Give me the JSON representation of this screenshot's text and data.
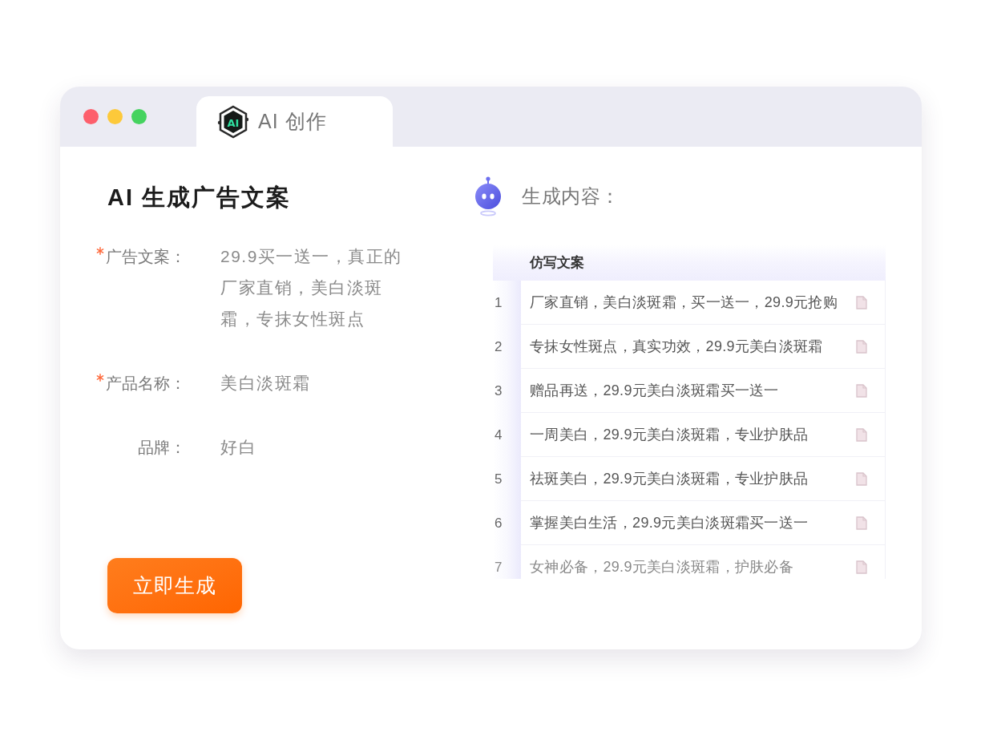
{
  "window": {
    "traffic_lights": [
      {
        "color": "#fd5f6c"
      },
      {
        "color": "#fdc93a"
      },
      {
        "color": "#45d35f"
      }
    ],
    "tab": {
      "logo": "AI",
      "label": "AI 创作",
      "selected": true
    }
  },
  "form": {
    "title": "AI 生成广告文案",
    "fields": [
      {
        "label": "广告文案：",
        "required": true,
        "value": "29.9买一送一，真正的厂家直销，美白淡斑霜，专抹女性斑点"
      },
      {
        "label": "产品名称：",
        "required": true,
        "value": "美白淡斑霜"
      },
      {
        "label": "品牌：",
        "required": false,
        "value": "好白"
      }
    ],
    "submit_button": "立即生成"
  },
  "output": {
    "title": "生成内容：",
    "table": {
      "columns": [
        "仿写文案"
      ],
      "rows": [
        {
          "index": "1",
          "text": "厂家直销，美白淡斑霜，买一送一，29.9元抢购"
        },
        {
          "index": "2",
          "text": "专抹女性斑点，真实功效，29.9元美白淡斑霜"
        },
        {
          "index": "3",
          "text": "赠品再送，29.9元美白淡斑霜买一送一"
        },
        {
          "index": "4",
          "text": "一周美白，29.9元美白淡斑霜，专业护肤品"
        },
        {
          "index": "5",
          "text": "祛斑美白，29.9元美白淡斑霜，专业护肤品"
        },
        {
          "index": "6",
          "text": "掌握美白生活，29.9元美白淡斑霜买一送一"
        },
        {
          "index": "7",
          "text": "女神必备，29.9元美白淡斑霜，护肤必备"
        }
      ]
    }
  }
}
